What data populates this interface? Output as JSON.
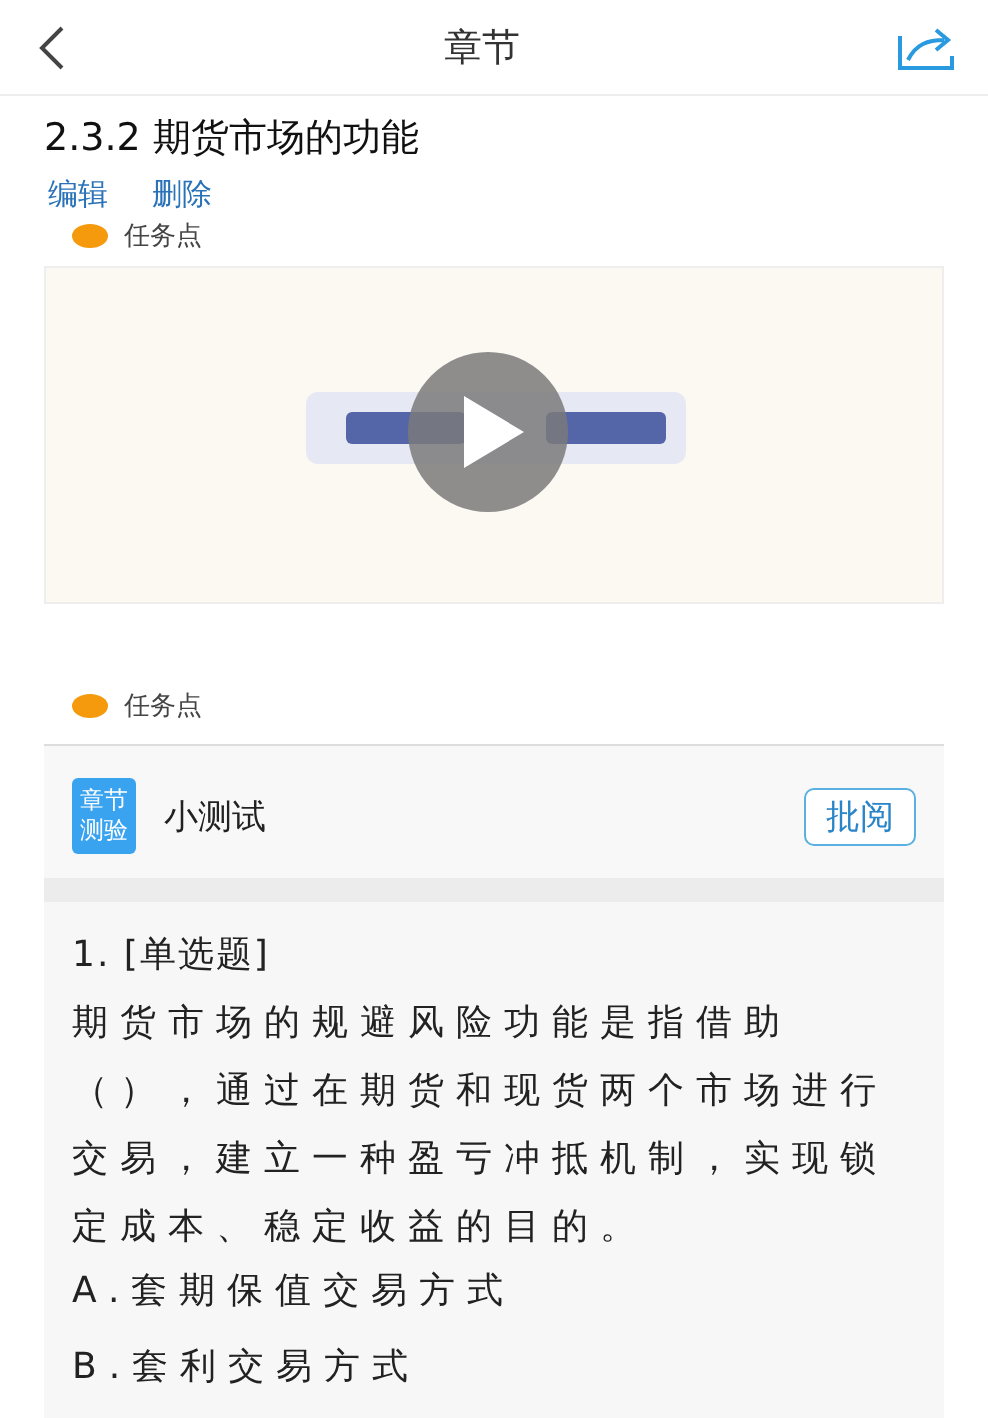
{
  "header": {
    "title": "章节"
  },
  "section": {
    "title": "2.3.2 期货市场的功能",
    "actions": [
      "编辑",
      "删除"
    ]
  },
  "task_points": [
    {
      "label": "任务点",
      "color": "#f59a0c"
    },
    {
      "label": "任务点",
      "color": "#f59a0c"
    }
  ],
  "quiz": {
    "badge_lines": [
      "章节",
      "测验"
    ],
    "title": "小测试",
    "review_button": "批阅"
  },
  "question": {
    "number": "1. [单选题]",
    "text": "期货市场的规避风险功能是指借助（），通过在期货和现货两个市场进行交易，建立一种盈亏冲抵机制，实现锁定成本、稳定收益的目的。",
    "options": [
      "A.套期保值交易方式",
      "B.套利交易方式"
    ]
  }
}
